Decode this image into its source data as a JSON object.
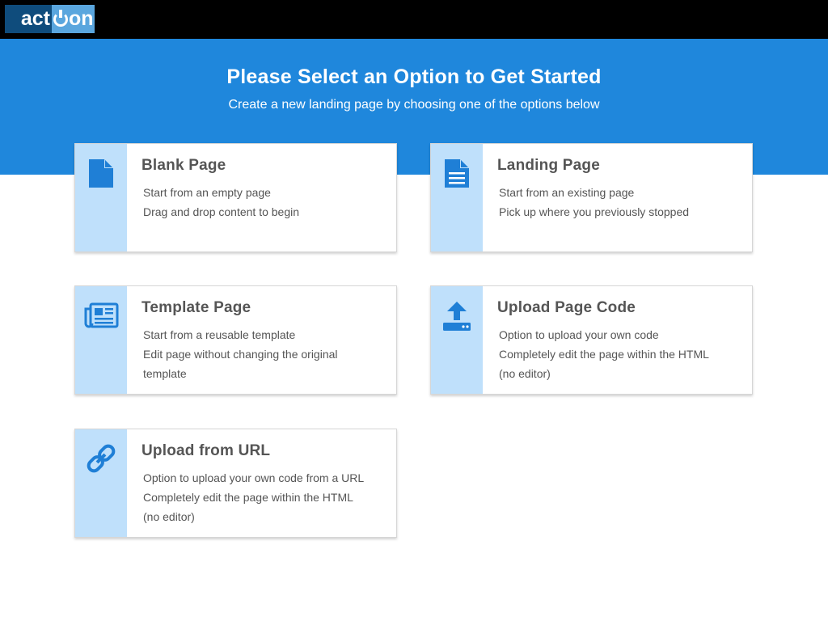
{
  "logo": {
    "left": "act",
    "right": "on"
  },
  "hero": {
    "title": "Please Select an Option to Get Started",
    "subtitle": "Create a new landing page by choosing one of the options below"
  },
  "options": [
    {
      "title": "Blank Page",
      "lines": [
        "Start from an empty page",
        "Drag and drop content to begin"
      ],
      "icon": "blank-page-icon"
    },
    {
      "title": "Landing Page",
      "lines": [
        "Start from an existing page",
        "Pick up where you previously stopped"
      ],
      "icon": "document-icon"
    },
    {
      "title": "Template Page",
      "lines": [
        "Start from a reusable template",
        "Edit page without changing the original",
        "template"
      ],
      "icon": "newspaper-icon"
    },
    {
      "title": "Upload Page Code",
      "lines": [
        "Option to upload your own code",
        "Completely edit the page within the HTML",
        "(no editor)"
      ],
      "icon": "upload-icon"
    },
    {
      "title": "Upload from URL",
      "lines": [
        "Option to upload your own code from a URL",
        "Completely edit the page within the HTML",
        "(no editor)"
      ],
      "icon": "link-icon"
    }
  ],
  "colors": {
    "accent": "#1f87dc",
    "strip": "#bfe0fb",
    "icon": "#1f7fd6",
    "topbar": "#000000"
  }
}
